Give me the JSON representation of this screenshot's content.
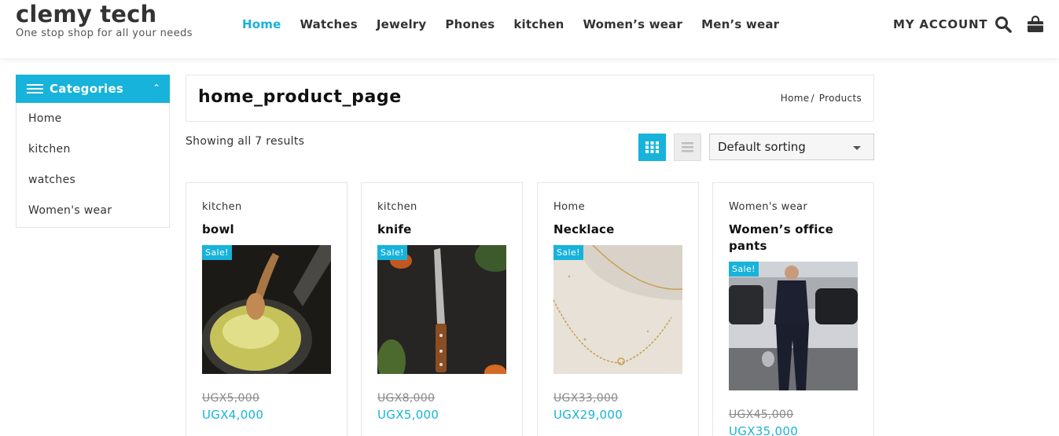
{
  "site": {
    "title": "clemy tech",
    "tagline": "One stop shop for all your needs"
  },
  "nav": {
    "items": [
      "Home",
      "Watches",
      "Jewelry",
      "Phones",
      "kitchen",
      "Women’s wear",
      "Men’s wear"
    ],
    "active": "Home",
    "account_label": "MY ACCOUNT",
    "icons": [
      "search-icon",
      "shopping-bag-icon"
    ]
  },
  "sidebar": {
    "heading": "Categories",
    "items": [
      "Home",
      "kitchen",
      "watches",
      "Women's wear"
    ]
  },
  "page": {
    "title": "home_product_page",
    "breadcrumb": [
      "Home",
      "Products"
    ],
    "breadcrumb_sep": "/",
    "results_text": "Showing all 7 results",
    "sort_value": "Default sorting"
  },
  "products": [
    {
      "category": "kitchen",
      "name": "bowl",
      "badge": "Sale!",
      "old_price": "UGX5,000",
      "price": "UGX4,000"
    },
    {
      "category": "kitchen",
      "name": "knife",
      "badge": "Sale!",
      "old_price": "UGX8,000",
      "price": "UGX5,000"
    },
    {
      "category": "Home",
      "name": "Necklace",
      "badge": "Sale!",
      "old_price": "UGX33,000",
      "price": "UGX29,000"
    },
    {
      "category": "Women's wear",
      "name": "Women’s office pants",
      "badge": "Sale!",
      "old_price": "UGX45,000",
      "price": "UGX35,000"
    }
  ],
  "colors": {
    "accent": "#17b3da",
    "text": "#222222"
  }
}
